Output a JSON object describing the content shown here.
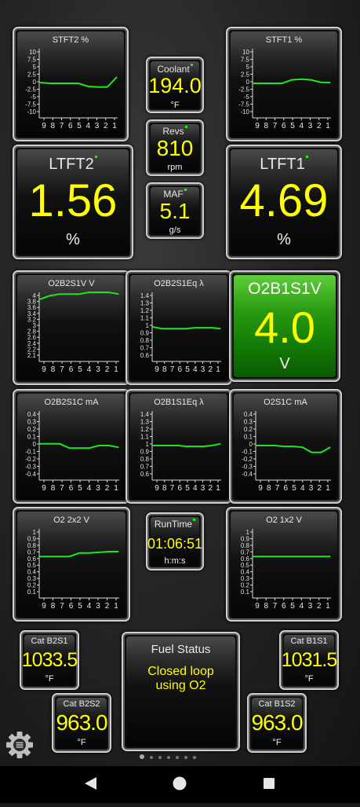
{
  "colors": {
    "value": "#ffff00",
    "trace": "#1ee61e",
    "active_bg": "#2a9a12"
  },
  "charts": {
    "stft2": {
      "title": "STFT2  %",
      "yticks": [
        "10",
        "7.5",
        "5",
        "2.5",
        "0",
        "-2.5",
        "-5",
        "-7.5",
        "-10"
      ],
      "xticks": [
        "9",
        "8",
        "7",
        "6",
        "5",
        "4",
        "3",
        "2",
        "1"
      ]
    },
    "stft1": {
      "title": "STFT1  %",
      "yticks": [
        "10",
        "7.5",
        "5",
        "2.5",
        "0",
        "-2.5",
        "-5",
        "-7.5",
        "-10"
      ],
      "xticks": [
        "9",
        "8",
        "7",
        "6",
        "5",
        "4",
        "3",
        "2",
        "1"
      ]
    },
    "o2b2s1v": {
      "title": "O2B2S1V  V",
      "yticks": [
        "4",
        "3.8",
        "3.6",
        "3.4",
        "3.2",
        "3",
        "2.8",
        "2.6",
        "2.4",
        "2.2",
        "2.1"
      ],
      "xticks": [
        "9",
        "8",
        "7",
        "6",
        "5",
        "4",
        "3",
        "2",
        "1"
      ]
    },
    "o2b2s1eq": {
      "title": "O2B2S1Eq  λ",
      "yticks": [
        "1.4",
        "1.3",
        "1.2",
        "1.1",
        "1",
        "0.9",
        "0.8",
        "0.7",
        "0.6"
      ],
      "xticks": [
        "9",
        "8",
        "7",
        "6",
        "5",
        "4",
        "3",
        "2",
        "1"
      ]
    },
    "o2b2s1c": {
      "title": "O2B2S1C  mA",
      "yticks": [
        "0.4",
        "0.3",
        "0.2",
        "0.1",
        "0",
        "-0.1",
        "-0.2",
        "-0.3",
        "-0.4"
      ],
      "xticks": [
        "9",
        "8",
        "7",
        "6",
        "5",
        "4",
        "3",
        "2",
        "1"
      ]
    },
    "o2b1s1eq": {
      "title": "O2B1S1Eq  λ",
      "yticks": [
        "1.4",
        "1.3",
        "1.2",
        "1.1",
        "1",
        "0.9",
        "0.8",
        "0.7",
        "0.6"
      ],
      "xticks": [
        "9",
        "8",
        "7",
        "6",
        "5",
        "4",
        "3",
        "2",
        "1"
      ]
    },
    "o2s1c": {
      "title": "O2S1C  mA",
      "yticks": [
        "0.4",
        "0.3",
        "0.2",
        "0.1",
        "0",
        "-0.1",
        "-0.2",
        "-0.3",
        "-0.4"
      ],
      "xticks": [
        "9",
        "8",
        "7",
        "6",
        "5",
        "4",
        "3",
        "2",
        "1"
      ]
    },
    "o2_2x2": {
      "title": "O2 2x2  V",
      "yticks": [
        "1",
        "0.9",
        "0.8",
        "0.7",
        "0.6",
        "0.5",
        "0.4",
        "0.3",
        "0.2",
        "0.1"
      ],
      "xticks": [
        "9",
        "8",
        "7",
        "6",
        "5",
        "4",
        "3",
        "2",
        "1"
      ]
    },
    "o2_1x2": {
      "title": "O2 1x2  V",
      "yticks": [
        "1",
        "0.9",
        "0.8",
        "0.7",
        "0.6",
        "0.5",
        "0.4",
        "0.3",
        "0.2",
        "0.1"
      ],
      "xticks": [
        "9",
        "8",
        "7",
        "6",
        "5",
        "4",
        "3",
        "2",
        "1"
      ]
    }
  },
  "gauges": {
    "coolant": {
      "label": "Coolant",
      "value": "194.0",
      "unit": "°F"
    },
    "revs": {
      "label": "Revs",
      "value": "810",
      "unit": "rpm"
    },
    "maf": {
      "label": "MAF",
      "value": "5.1",
      "unit": "g/s"
    },
    "ltft2": {
      "label": "LTFT2",
      "value": "1.56",
      "unit": "%"
    },
    "ltft1": {
      "label": "LTFT1",
      "value": "4.69",
      "unit": "%"
    },
    "o2b1s1v": {
      "label": "O2B1S1V",
      "value": "4.0",
      "unit": "V"
    },
    "runtime": {
      "label": "RunTime",
      "value": "01:06:51",
      "unit": "h:m:s"
    },
    "catb2s1": {
      "label": "Cat B2S1",
      "value": "1033.5",
      "unit": "°F"
    },
    "catb1s1": {
      "label": "Cat B1S1",
      "value": "1031.5",
      "unit": "°F"
    },
    "catb2s2": {
      "label": "Cat B2S2",
      "value": "963.0",
      "unit": "°F"
    },
    "catb1s2": {
      "label": "Cat B1S2",
      "value": "963.0",
      "unit": "°F"
    },
    "fuel": {
      "label": "Fuel Status",
      "value_line1": "Closed loop",
      "value_line2": "using O2"
    }
  },
  "pager": {
    "pages": 7,
    "current": 1
  },
  "icons": {
    "settings": "gear-icon",
    "back": "back-triangle-icon",
    "home": "home-circle-icon",
    "recents": "recents-square-icon"
  },
  "chart_data": [
    {
      "type": "line",
      "title": "STFT2  %",
      "ylim": [
        -10,
        10
      ],
      "x": [
        9,
        8,
        7,
        6,
        5,
        4,
        3,
        2,
        1
      ],
      "series": [
        {
          "values": [
            0.2,
            0,
            0,
            0,
            0,
            -0.9,
            -1.1,
            -1.1,
            1.8
          ]
        }
      ]
    },
    {
      "type": "line",
      "title": "STFT1  %",
      "ylim": [
        -10,
        10
      ],
      "x": [
        9,
        8,
        7,
        6,
        5,
        4,
        3,
        2,
        1
      ],
      "series": [
        {
          "values": [
            0,
            0,
            0,
            0,
            1,
            1.2,
            1,
            0.3,
            0.2
          ]
        }
      ]
    },
    {
      "type": "line",
      "title": "O2B2S1V  V",
      "ylim": [
        2.1,
        4.1
      ],
      "x": [
        9,
        8,
        7,
        6,
        5,
        4,
        3,
        2,
        1
      ],
      "series": [
        {
          "values": [
            3.9,
            4.0,
            4.05,
            4.05,
            4.05,
            4.1,
            4.1,
            4.1,
            4.05
          ]
        }
      ]
    },
    {
      "type": "line",
      "title": "O2B2S1Eq  λ",
      "ylim": [
        0.6,
        1.4
      ],
      "x": [
        9,
        8,
        7,
        6,
        5,
        4,
        3,
        2,
        1
      ],
      "series": [
        {
          "values": [
            1.0,
            0.98,
            0.98,
            0.98,
            0.98,
            0.99,
            0.99,
            0.99,
            0.98
          ]
        }
      ]
    },
    {
      "type": "line",
      "title": "O2B2S1C  mA",
      "ylim": [
        -0.4,
        0.4
      ],
      "x": [
        9,
        8,
        7,
        6,
        5,
        4,
        3,
        2,
        1
      ],
      "series": [
        {
          "values": [
            0.02,
            0.02,
            0.02,
            -0.03,
            -0.03,
            -0.03,
            0,
            0,
            -0.02
          ]
        }
      ]
    },
    {
      "type": "line",
      "title": "O2B1S1Eq  λ",
      "ylim": [
        0.6,
        1.4
      ],
      "x": [
        9,
        8,
        7,
        6,
        5,
        4,
        3,
        2,
        1
      ],
      "series": [
        {
          "values": [
            1.0,
            1.0,
            1.0,
            1.0,
            0.99,
            0.99,
            0.99,
            1.0,
            1.02
          ]
        }
      ]
    },
    {
      "type": "line",
      "title": "O2S1C  mA",
      "ylim": [
        -0.4,
        0.4
      ],
      "x": [
        9,
        8,
        7,
        6,
        5,
        4,
        3,
        2,
        1
      ],
      "series": [
        {
          "values": [
            0,
            0,
            0,
            -0.01,
            -0.01,
            -0.02,
            -0.08,
            -0.08,
            -0.02
          ]
        }
      ]
    },
    {
      "type": "line",
      "title": "O2 2x2  V",
      "ylim": [
        0,
        1
      ],
      "x": [
        9,
        8,
        7,
        6,
        5,
        4,
        3,
        2,
        1
      ],
      "series": [
        {
          "values": [
            0.6,
            0.6,
            0.6,
            0.6,
            0.65,
            0.65,
            0.66,
            0.67,
            0.67
          ]
        }
      ]
    },
    {
      "type": "line",
      "title": "O2 1x2  V",
      "ylim": [
        0,
        1
      ],
      "x": [
        9,
        8,
        7,
        6,
        5,
        4,
        3,
        2,
        1
      ],
      "series": [
        {
          "values": [
            0.6,
            0.6,
            0.6,
            0.6,
            0.6,
            0.6,
            0.6,
            0.6,
            0.6
          ]
        }
      ]
    }
  ]
}
